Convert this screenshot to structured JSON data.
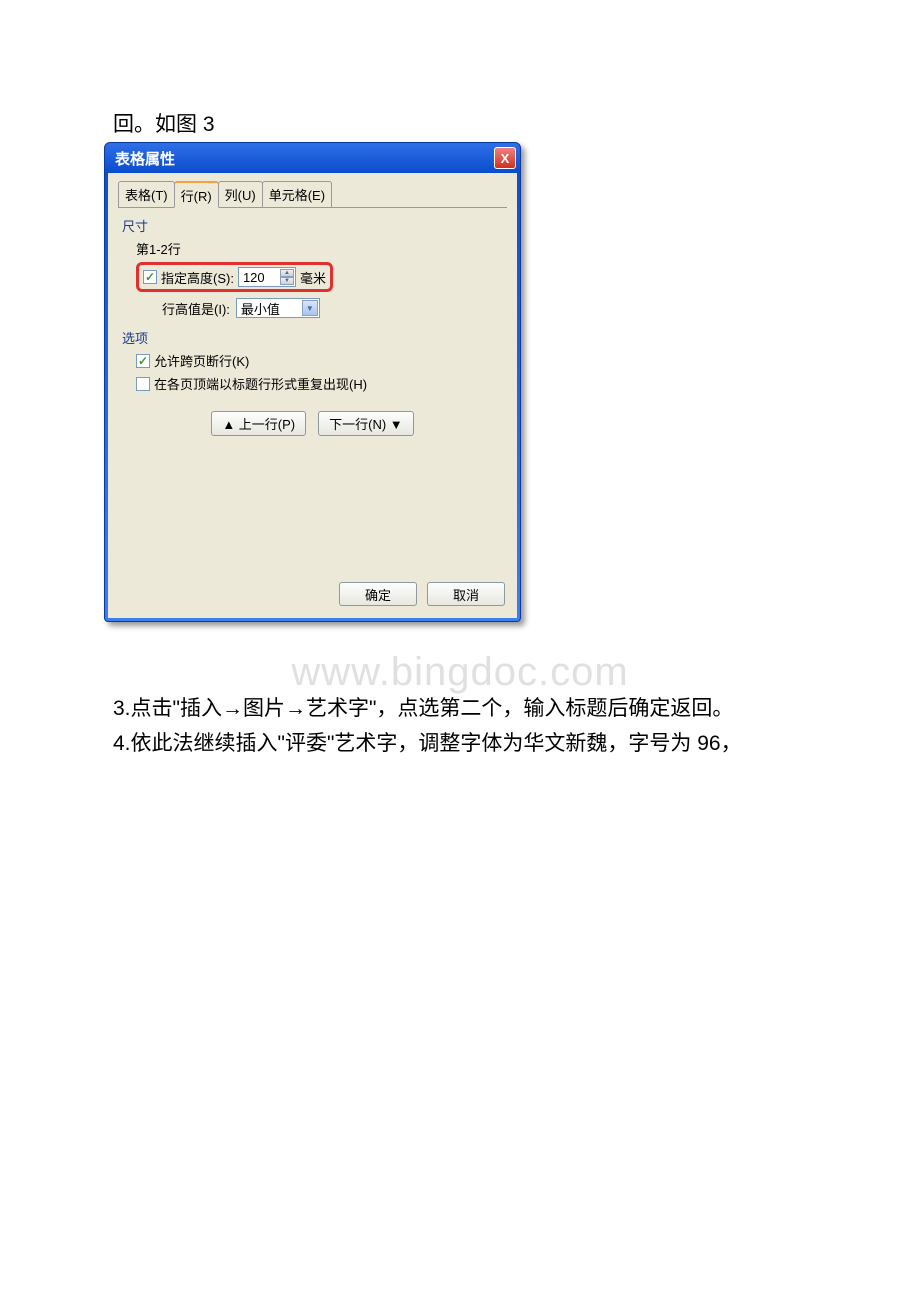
{
  "text": {
    "line1": "回。如图 3",
    "line2": "3.点击\"插入→图片→艺术字\"，点选第二个，输入标题后确定返回。",
    "line3": "4.依此法继续插入\"评委\"艺术字，调整字体为华文新魏，字号为 96，"
  },
  "watermark": "www.bingdoc.com",
  "dialog": {
    "title": "表格属性",
    "close": "X",
    "tabs": {
      "table": "表格(T)",
      "row": "行(R)",
      "column": "列(U)",
      "cell": "单元格(E)"
    },
    "size": {
      "label": "尺寸",
      "rowRange": "第1-2行",
      "specifyHeight": "指定高度(S):",
      "heightValue": "120",
      "unit": "毫米",
      "rowHeightIs": "行高值是(I):",
      "rowHeightValue": "最小值"
    },
    "options": {
      "label": "选项",
      "allowBreak": "允许跨页断行(K)",
      "repeatHeader": "在各页顶端以标题行形式重复出现(H)"
    },
    "nav": {
      "prev": "▲ 上一行(P)",
      "next": "下一行(N) ▼"
    },
    "buttons": {
      "ok": "确定",
      "cancel": "取消"
    }
  }
}
